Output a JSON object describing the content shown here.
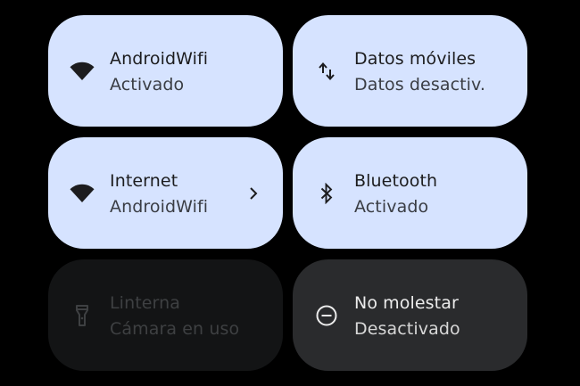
{
  "tiles": [
    {
      "title": "AndroidWifi",
      "subtitle": "Activado",
      "icon": "wifi-icon",
      "state": "on"
    },
    {
      "title": "Datos móviles",
      "subtitle": "Datos desactiv.",
      "icon": "mobile-data-icon",
      "state": "on"
    },
    {
      "title": "Internet",
      "subtitle": "AndroidWifi",
      "icon": "wifi-icon",
      "state": "on",
      "has_chevron": true
    },
    {
      "title": "Bluetooth",
      "subtitle": "Activado",
      "icon": "bluetooth-icon",
      "state": "on"
    },
    {
      "title": "Linterna",
      "subtitle": "Cámara en uso",
      "icon": "flashlight-icon",
      "state": "disabled"
    },
    {
      "title": "No molestar",
      "subtitle": "Desactivado",
      "icon": "do-not-disturb-icon",
      "state": "off"
    }
  ],
  "colors": {
    "background": "#000000",
    "tile_on": "#d6e3ff",
    "tile_off": "#2a2b2d",
    "tile_disabled": "#131415"
  }
}
